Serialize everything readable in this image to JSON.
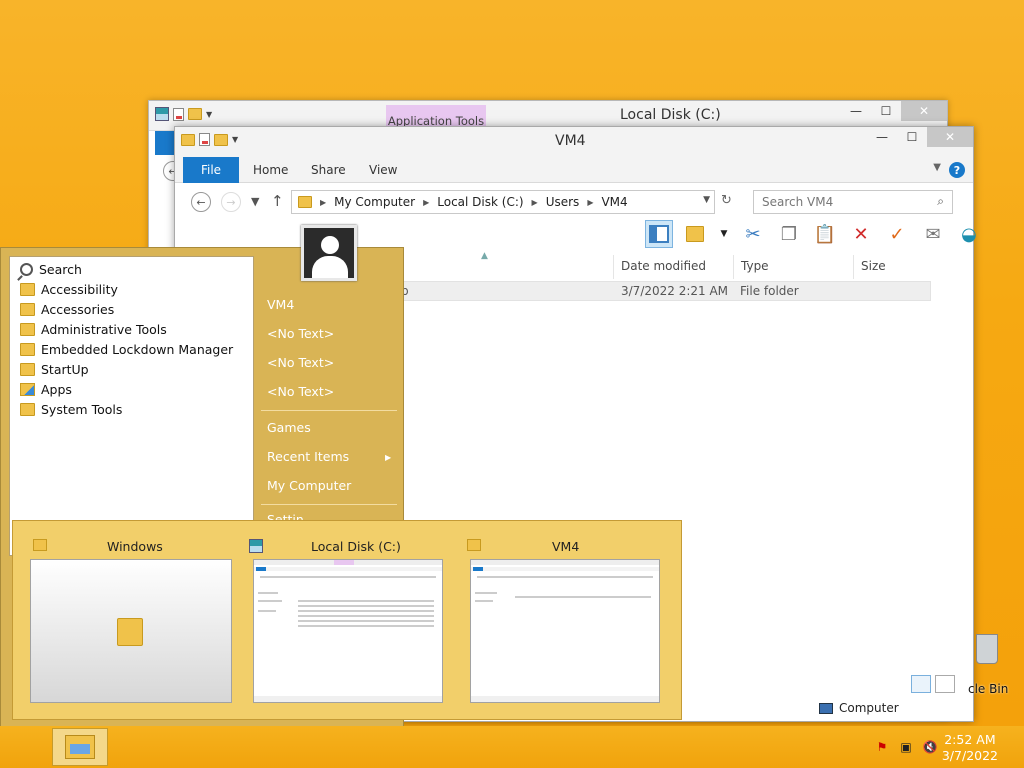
{
  "back_window": {
    "contextual_tab": "Application Tools",
    "title": "Local Disk (C:)",
    "controls": {
      "minimize": "—",
      "maximize": "☐",
      "close": "✕"
    }
  },
  "front_window": {
    "title": "VM4",
    "controls": {
      "minimize": "—",
      "maximize": "☐",
      "close": "✕"
    },
    "ribbon_tabs": {
      "file": "File",
      "home": "Home",
      "share": "Share",
      "view": "View"
    },
    "help": "?",
    "address": {
      "crumbs": [
        "My Computer",
        "Local Disk (C:)",
        "Users",
        "VM4"
      ]
    },
    "search": {
      "placeholder": "Search VM4"
    },
    "columns": {
      "name": "",
      "date": "Date modified",
      "type": "Type",
      "size": "Size"
    },
    "row": {
      "name": "Desktop",
      "name_visible": "ktop",
      "date": "3/7/2022 2:21 AM",
      "type": "File folder"
    },
    "status": {
      "location": "Computer"
    }
  },
  "start_menu": {
    "items": [
      {
        "label": "Search",
        "icon": "search-icon"
      },
      {
        "label": "Accessibility",
        "icon": "folder-icon"
      },
      {
        "label": "Accessories",
        "icon": "folder-icon"
      },
      {
        "label": "Administrative Tools",
        "icon": "folder-icon"
      },
      {
        "label": "Embedded Lockdown Manager",
        "icon": "folder-icon"
      },
      {
        "label": "StartUp",
        "icon": "folder-icon"
      },
      {
        "label": "Apps",
        "icon": "apps-icon"
      },
      {
        "label": "System Tools",
        "icon": "folder-icon"
      }
    ],
    "right": {
      "user": "VM4",
      "no_text_1": "<No Text>",
      "no_text_2": "<No Text>",
      "no_text_3": "<No Text>",
      "games": "Games",
      "recent_items": "Recent Items",
      "my_computer": "My Computer",
      "settings_partial": "Settin..."
    }
  },
  "switcher": {
    "thumbs": [
      {
        "title": "Windows",
        "icon": "folder-icon"
      },
      {
        "title": "Local Disk (C:)",
        "icon": "disk-icon"
      },
      {
        "title": "VM4",
        "icon": "folder-icon"
      }
    ]
  },
  "desktop": {
    "recycle_bin_label": "cle Bin"
  },
  "taskbar": {
    "time": "2:52 AM",
    "date": "3/7/2022"
  },
  "colors": {
    "accent": "#1979ca",
    "desktop": "#f6a912",
    "start_menu": "#d9b455"
  }
}
